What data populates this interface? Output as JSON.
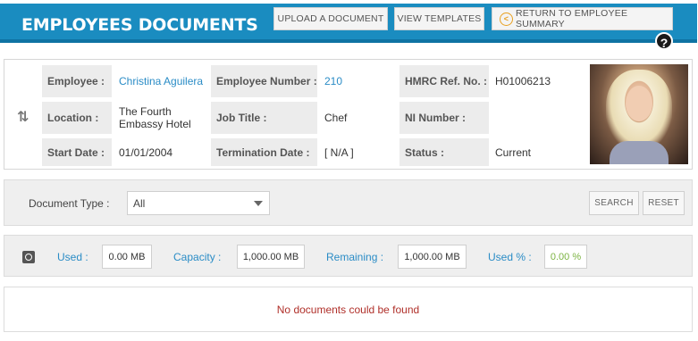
{
  "header": {
    "title": "EMPLOYEES DOCUMENTS",
    "upload_label": "UPLOAD A DOCUMENT",
    "templates_label": "VIEW TEMPLATES",
    "return_label": "RETURN TO EMPLOYEE SUMMARY",
    "help_glyph": "?"
  },
  "employee": {
    "employee_label": "Employee :",
    "employee_value": "Christina Aguilera",
    "number_label": "Employee Number :",
    "number_value": "210",
    "hmrc_label": "HMRC Ref. No. :",
    "hmrc_value": "H01006213",
    "location_label": "Location :",
    "location_value": "The Fourth Embassy Hotel",
    "job_label": "Job Title :",
    "job_value": "Chef",
    "ni_label": "NI Number :",
    "ni_value": "",
    "start_label": "Start Date :",
    "start_value": "01/01/2004",
    "term_label": "Termination Date :",
    "term_value": "[ N/A ]",
    "status_label": "Status :",
    "status_value": "Current"
  },
  "filter": {
    "doc_type_label": "Document Type :",
    "doc_type_value": "All",
    "search_label": "SEARCH",
    "reset_label": "RESET"
  },
  "usage": {
    "used_label": "Used :",
    "used_value": "0.00 MB",
    "capacity_label": "Capacity :",
    "capacity_value": "1,000.00 MB",
    "remaining_label": "Remaining :",
    "remaining_value": "1,000.00 MB",
    "used_pct_label": "Used % :",
    "used_pct_value": "0.00 %"
  },
  "results": {
    "empty_message": "No documents could be found"
  },
  "colors": {
    "header_blue": "#1a8cc0",
    "link_blue": "#2a8cc6",
    "empty_red": "#b0302a",
    "pct_green": "#7cb342"
  }
}
